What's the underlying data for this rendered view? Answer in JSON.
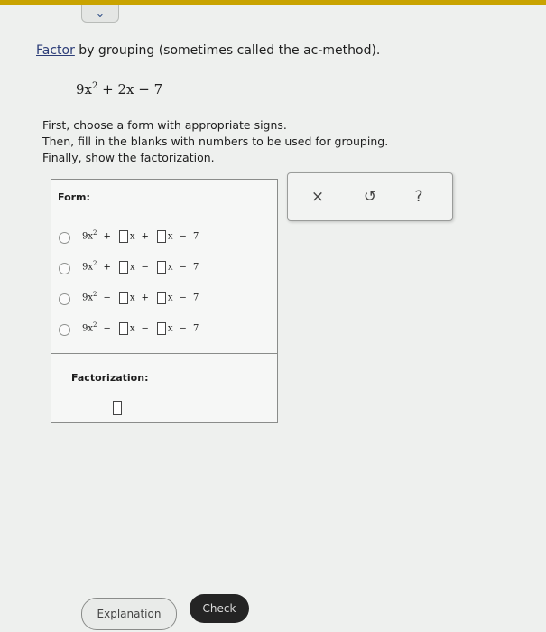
{
  "header": {
    "collapse_icon": "chevron-down"
  },
  "instruction": {
    "link": "Factor",
    "rest": " by grouping (sometimes called the ac-method)."
  },
  "expression": {
    "coef": "9x",
    "exp": "2",
    "tail": " + 2x − 7"
  },
  "directions": [
    "First, choose a form with appropriate signs.",
    "Then, fill in the blanks with numbers to be used for grouping.",
    "Finally, show the factorization."
  ],
  "form": {
    "title": "Form:",
    "options": [
      {
        "lead": "9x",
        "exp": "2",
        "s1": "+",
        "var1": "x",
        "s2": "+",
        "var2": "x",
        "s3": "−",
        "const": "7"
      },
      {
        "lead": "9x",
        "exp": "2",
        "s1": "+",
        "var1": "x",
        "s2": "−",
        "var2": "x",
        "s3": "−",
        "const": "7"
      },
      {
        "lead": "9x",
        "exp": "2",
        "s1": "−",
        "var1": "x",
        "s2": "+",
        "var2": "x",
        "s3": "−",
        "const": "7"
      },
      {
        "lead": "9x",
        "exp": "2",
        "s1": "−",
        "var1": "x",
        "s2": "−",
        "var2": "x",
        "s3": "−",
        "const": "7"
      }
    ],
    "factorization_title": "Factorization:"
  },
  "tools": {
    "clear": "×",
    "undo": "↺",
    "help": "?"
  },
  "buttons": {
    "explanation": "Explanation",
    "check": "Check"
  }
}
